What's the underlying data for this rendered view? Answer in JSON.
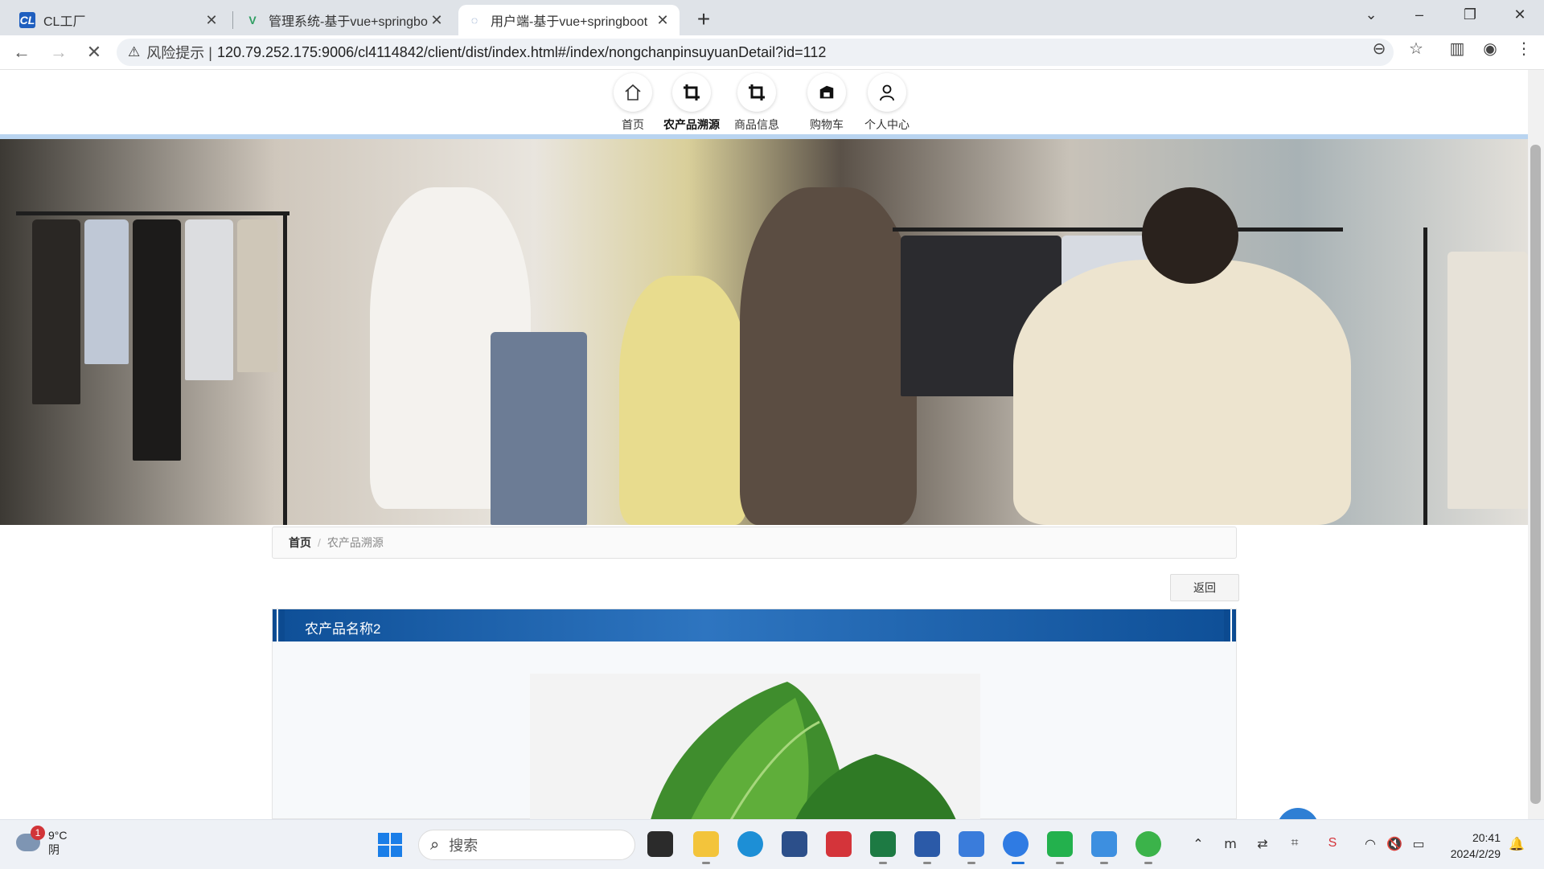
{
  "browser": {
    "tabs": [
      {
        "label": "CL工厂",
        "icon": "CL"
      },
      {
        "label": "管理系统-基于vue+springbo",
        "icon": "V"
      },
      {
        "label": "用户端-基于vue+springboot",
        "icon": "◌"
      }
    ],
    "close_glyph": "✕",
    "new_tab": "+",
    "address": {
      "risk_label": "风险提示 |",
      "url": "120.79.252.175:9006/cl4114842/client/dist/index.html#/index/nongchanpinsuyuanDetail?id=112"
    }
  },
  "nav": {
    "items": [
      {
        "label": "首页",
        "icon": "home-icon"
      },
      {
        "label": "农产品溯源",
        "icon": "crop-icon"
      },
      {
        "label": "商品信息",
        "icon": "crop-icon"
      },
      {
        "label": "购物车",
        "icon": "cart-icon"
      },
      {
        "label": "个人中心",
        "icon": "user-icon"
      }
    ],
    "active_index": 1
  },
  "breadcrumb": {
    "home": "首页",
    "separator": "/",
    "current": "农产品溯源"
  },
  "detail": {
    "back_label": "返回",
    "title": "农产品名称2"
  },
  "taskbar": {
    "weather_temp": "9°C",
    "weather_desc": "阴",
    "weather_badge": "1",
    "search_placeholder": "搜索",
    "time": "20:41",
    "date": "2024/2/29"
  },
  "colors": {
    "title_bar": "#1b62b0",
    "nav_underline": "#b9d4f0",
    "accent": "#2f7fd4"
  }
}
